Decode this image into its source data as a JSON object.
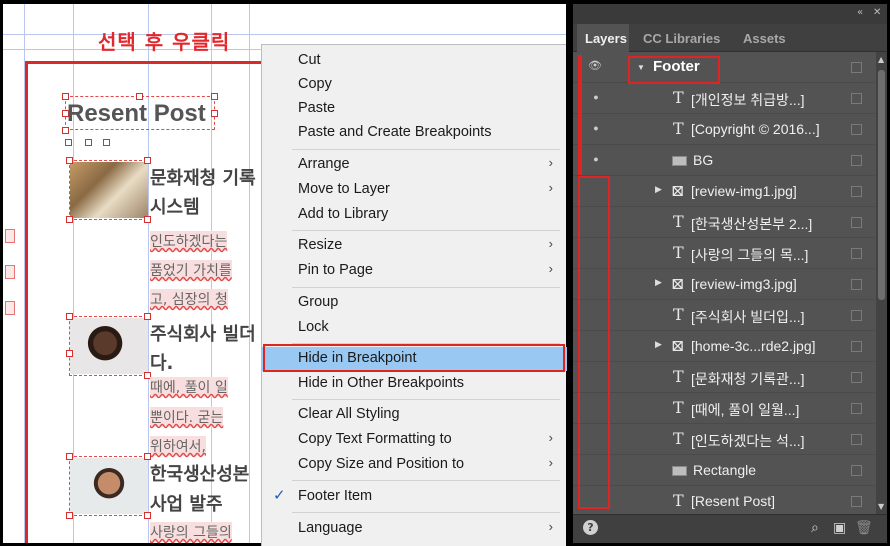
{
  "annotation": "선택 후 우클릭",
  "canvas": {
    "post_title": "Resent Post",
    "posts": [
      {
        "title1": "문화재청 기록",
        "title2": "시스템",
        "body": [
          "인도하겠다는",
          "품었기 가치를",
          "고, 심장의 청"
        ]
      },
      {
        "title1": "주식회사 빌더",
        "title2": "다.",
        "body": [
          "때에, 풀이 일",
          "뿐이다. 굳는",
          "위하여서,"
        ]
      },
      {
        "title1": "한국생산성본",
        "title2": "사업 발주",
        "body": [
          "사랑의 그들의"
        ]
      }
    ]
  },
  "context_menu": {
    "items": [
      {
        "label": "Cut",
        "submenu": false
      },
      {
        "label": "Copy",
        "submenu": false
      },
      {
        "label": "Paste",
        "submenu": false
      },
      {
        "label": "Paste and Create Breakpoints",
        "submenu": false
      },
      {
        "label": "Arrange",
        "submenu": true
      },
      {
        "label": "Move to Layer",
        "submenu": true
      },
      {
        "label": "Add to Library",
        "submenu": false
      },
      {
        "label": "Resize",
        "submenu": true
      },
      {
        "label": "Pin to Page",
        "submenu": true
      },
      {
        "label": "Group",
        "submenu": false
      },
      {
        "label": "Lock",
        "submenu": false
      },
      {
        "label": "Hide in Breakpoint",
        "submenu": false,
        "highlighted": true
      },
      {
        "label": "Hide in Other Breakpoints",
        "submenu": false
      },
      {
        "label": "Clear All Styling",
        "submenu": false
      },
      {
        "label": "Copy Text Formatting to",
        "submenu": true
      },
      {
        "label": "Copy Size and Position to",
        "submenu": true
      },
      {
        "label": "Footer Item",
        "submenu": false,
        "checked": true
      },
      {
        "label": "Language",
        "submenu": true
      }
    ],
    "arrow_glyph": "›",
    "check_glyph": "✓"
  },
  "panel": {
    "collapse_glyph": "«",
    "close_glyph": "✕",
    "tabs": [
      "Layers",
      "CC Libraries",
      "Assets"
    ],
    "active_tab": "Layers",
    "layers": [
      {
        "name": "Footer",
        "type": "group",
        "visible_icon": "eye-icon",
        "expanded": true
      },
      {
        "name": "[개인정보 취급방...]",
        "type": "text",
        "visible_icon": "dot"
      },
      {
        "name": "[Copyright © 2016...]",
        "type": "text",
        "visible_icon": "dot"
      },
      {
        "name": "BG",
        "type": "rect",
        "visible_icon": "dot"
      },
      {
        "name": "[review-img1.jpg]",
        "type": "image",
        "expandable": true
      },
      {
        "name": "[한국생산성본부 2...]",
        "type": "text"
      },
      {
        "name": "[사랑의 그들의 목...]",
        "type": "text"
      },
      {
        "name": "[review-img3.jpg]",
        "type": "image",
        "expandable": true
      },
      {
        "name": "[주식회사 빌더입...]",
        "type": "text"
      },
      {
        "name": "[home-3c...rde2.jpg]",
        "type": "image",
        "expandable": true
      },
      {
        "name": "[문화재청 기록관...]",
        "type": "text"
      },
      {
        "name": "[때에, 풀이 일월...]",
        "type": "text"
      },
      {
        "name": "[인도하겠다는 석...]",
        "type": "text"
      },
      {
        "name": "Rectangle",
        "type": "rect"
      },
      {
        "name": "[Resent Post]",
        "type": "text"
      }
    ],
    "glyphs": {
      "text": "T",
      "expand": "▶",
      "collapse": "▼",
      "image": "⊠",
      "dot": "●",
      "eye": "👁"
    },
    "bottom": {
      "help": "?",
      "search": "⌕",
      "new_layer": "▣",
      "delete": "🗑"
    }
  },
  "colors": {
    "accent_red": "#e02424",
    "highlight_blue": "#99c9f3",
    "panel_bg": "#535353"
  }
}
